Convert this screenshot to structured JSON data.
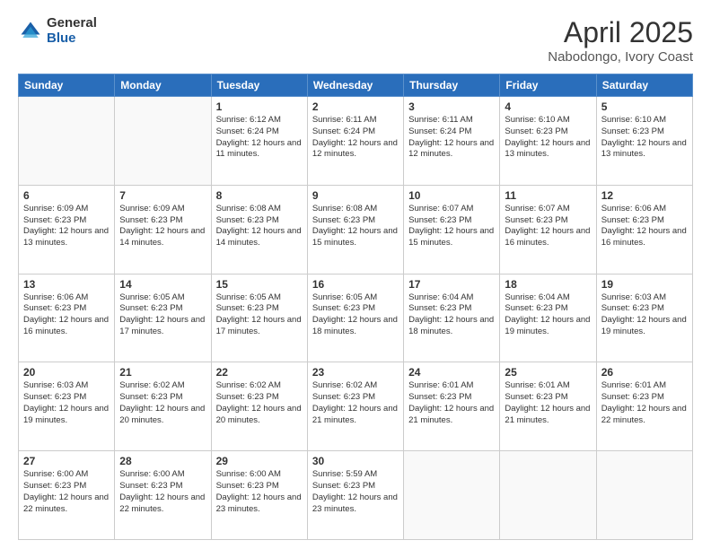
{
  "logo": {
    "general": "General",
    "blue": "Blue"
  },
  "header": {
    "month": "April 2025",
    "location": "Nabodongo, Ivory Coast"
  },
  "weekdays": [
    "Sunday",
    "Monday",
    "Tuesday",
    "Wednesday",
    "Thursday",
    "Friday",
    "Saturday"
  ],
  "weeks": [
    [
      {
        "day": "",
        "info": ""
      },
      {
        "day": "",
        "info": ""
      },
      {
        "day": "1",
        "info": "Sunrise: 6:12 AM\nSunset: 6:24 PM\nDaylight: 12 hours and 11 minutes."
      },
      {
        "day": "2",
        "info": "Sunrise: 6:11 AM\nSunset: 6:24 PM\nDaylight: 12 hours and 12 minutes."
      },
      {
        "day": "3",
        "info": "Sunrise: 6:11 AM\nSunset: 6:24 PM\nDaylight: 12 hours and 12 minutes."
      },
      {
        "day": "4",
        "info": "Sunrise: 6:10 AM\nSunset: 6:23 PM\nDaylight: 12 hours and 13 minutes."
      },
      {
        "day": "5",
        "info": "Sunrise: 6:10 AM\nSunset: 6:23 PM\nDaylight: 12 hours and 13 minutes."
      }
    ],
    [
      {
        "day": "6",
        "info": "Sunrise: 6:09 AM\nSunset: 6:23 PM\nDaylight: 12 hours and 13 minutes."
      },
      {
        "day": "7",
        "info": "Sunrise: 6:09 AM\nSunset: 6:23 PM\nDaylight: 12 hours and 14 minutes."
      },
      {
        "day": "8",
        "info": "Sunrise: 6:08 AM\nSunset: 6:23 PM\nDaylight: 12 hours and 14 minutes."
      },
      {
        "day": "9",
        "info": "Sunrise: 6:08 AM\nSunset: 6:23 PM\nDaylight: 12 hours and 15 minutes."
      },
      {
        "day": "10",
        "info": "Sunrise: 6:07 AM\nSunset: 6:23 PM\nDaylight: 12 hours and 15 minutes."
      },
      {
        "day": "11",
        "info": "Sunrise: 6:07 AM\nSunset: 6:23 PM\nDaylight: 12 hours and 16 minutes."
      },
      {
        "day": "12",
        "info": "Sunrise: 6:06 AM\nSunset: 6:23 PM\nDaylight: 12 hours and 16 minutes."
      }
    ],
    [
      {
        "day": "13",
        "info": "Sunrise: 6:06 AM\nSunset: 6:23 PM\nDaylight: 12 hours and 16 minutes."
      },
      {
        "day": "14",
        "info": "Sunrise: 6:05 AM\nSunset: 6:23 PM\nDaylight: 12 hours and 17 minutes."
      },
      {
        "day": "15",
        "info": "Sunrise: 6:05 AM\nSunset: 6:23 PM\nDaylight: 12 hours and 17 minutes."
      },
      {
        "day": "16",
        "info": "Sunrise: 6:05 AM\nSunset: 6:23 PM\nDaylight: 12 hours and 18 minutes."
      },
      {
        "day": "17",
        "info": "Sunrise: 6:04 AM\nSunset: 6:23 PM\nDaylight: 12 hours and 18 minutes."
      },
      {
        "day": "18",
        "info": "Sunrise: 6:04 AM\nSunset: 6:23 PM\nDaylight: 12 hours and 19 minutes."
      },
      {
        "day": "19",
        "info": "Sunrise: 6:03 AM\nSunset: 6:23 PM\nDaylight: 12 hours and 19 minutes."
      }
    ],
    [
      {
        "day": "20",
        "info": "Sunrise: 6:03 AM\nSunset: 6:23 PM\nDaylight: 12 hours and 19 minutes."
      },
      {
        "day": "21",
        "info": "Sunrise: 6:02 AM\nSunset: 6:23 PM\nDaylight: 12 hours and 20 minutes."
      },
      {
        "day": "22",
        "info": "Sunrise: 6:02 AM\nSunset: 6:23 PM\nDaylight: 12 hours and 20 minutes."
      },
      {
        "day": "23",
        "info": "Sunrise: 6:02 AM\nSunset: 6:23 PM\nDaylight: 12 hours and 21 minutes."
      },
      {
        "day": "24",
        "info": "Sunrise: 6:01 AM\nSunset: 6:23 PM\nDaylight: 12 hours and 21 minutes."
      },
      {
        "day": "25",
        "info": "Sunrise: 6:01 AM\nSunset: 6:23 PM\nDaylight: 12 hours and 21 minutes."
      },
      {
        "day": "26",
        "info": "Sunrise: 6:01 AM\nSunset: 6:23 PM\nDaylight: 12 hours and 22 minutes."
      }
    ],
    [
      {
        "day": "27",
        "info": "Sunrise: 6:00 AM\nSunset: 6:23 PM\nDaylight: 12 hours and 22 minutes."
      },
      {
        "day": "28",
        "info": "Sunrise: 6:00 AM\nSunset: 6:23 PM\nDaylight: 12 hours and 22 minutes."
      },
      {
        "day": "29",
        "info": "Sunrise: 6:00 AM\nSunset: 6:23 PM\nDaylight: 12 hours and 23 minutes."
      },
      {
        "day": "30",
        "info": "Sunrise: 5:59 AM\nSunset: 6:23 PM\nDaylight: 12 hours and 23 minutes."
      },
      {
        "day": "",
        "info": ""
      },
      {
        "day": "",
        "info": ""
      },
      {
        "day": "",
        "info": ""
      }
    ]
  ]
}
